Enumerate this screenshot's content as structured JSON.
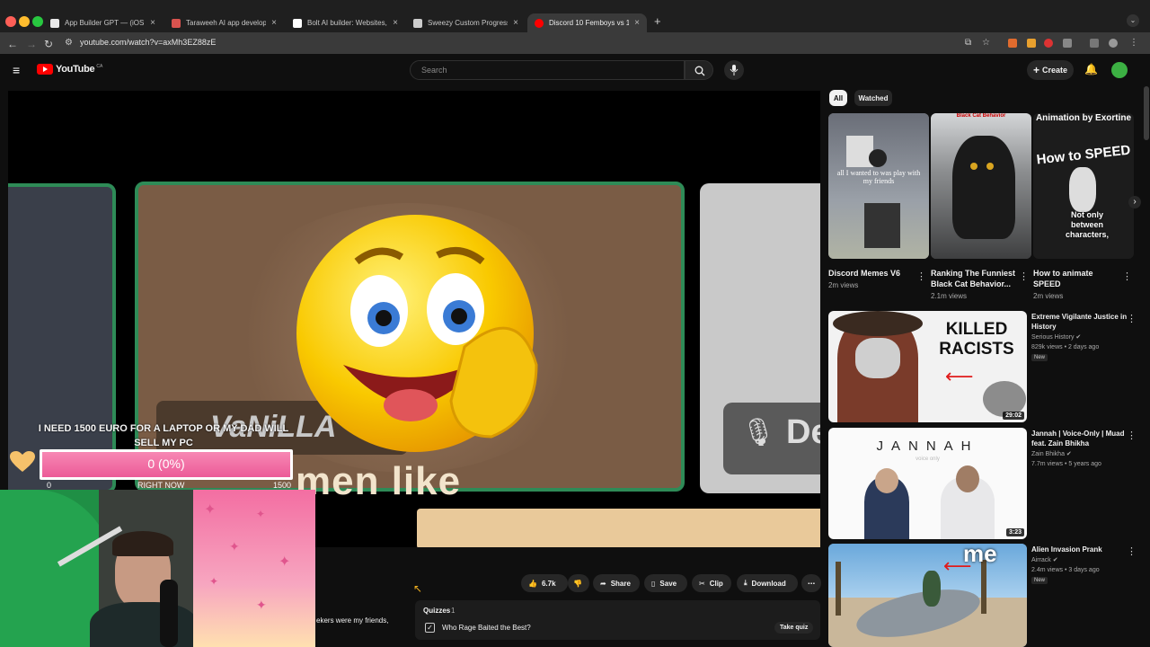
{
  "browser": {
    "tabs": [
      {
        "label": "App Builder GPT — (iOS & An",
        "favicon_color": "#e8e8e8"
      },
      {
        "label": "Taraweeh AI app developme",
        "favicon_color": "#d9534f"
      },
      {
        "label": "Bolt AI builder: Websites, app",
        "favicon_color": "#ffffff"
      },
      {
        "label": "Sweezy Custom Progress Bar",
        "favicon_color": "#cccccc"
      },
      {
        "label": "Discord 10 Femboys vs 1",
        "favicon_color": "#ff0000"
      }
    ],
    "url": "youtube.com/watch?v=axMh3EZ88zE"
  },
  "youtube": {
    "logo_text": "YouTube",
    "logo_suffix": "CA",
    "search_placeholder": "Search",
    "create_label": "Create"
  },
  "overlay": {
    "goal_text_line1": "I NEED 1500 EURO FOR A LAPTOP OR MY DAD WILL",
    "goal_text_line2": "SELL MY PC",
    "progress_label": "0 (0%)",
    "progress_fraction": 0.0,
    "min_label": "0",
    "mid_label": "RIGHT NOW",
    "max_label": "1500"
  },
  "video": {
    "caption": "men like",
    "badge_text": "VaNiLLA",
    "side_text": "De"
  },
  "actions": {
    "like_count": "6.7k",
    "share": "Share",
    "save": "Save",
    "clip": "Clip",
    "download": "Download"
  },
  "quiz": {
    "header": "Quizzes",
    "count": "1",
    "question": "Who Rage Baited the Best?",
    "take_label": "Take quiz"
  },
  "comment_snippet": "ekers were my friends,",
  "filters": {
    "all": "All",
    "watched": "Watched"
  },
  "shorts": [
    {
      "title": "Discord Memes V6",
      "views": "2m views",
      "thumb_text": "all I wanted to was play with my friends"
    },
    {
      "title": "Ranking The Funniest Black Cat Behavior...",
      "views": "2.1m views",
      "thumb_text": "Black Cat Behavior"
    },
    {
      "title": "How to animate SPEED",
      "views": "2m views",
      "thumb_text": "Animation by Exortine",
      "thumb_sub": "How to SPEED",
      "thumb_sub2": "Not only between characters,"
    }
  ],
  "related": [
    {
      "title": "Extreme Vigilante Justice in History",
      "channel": "Serious History",
      "meta": "829k views • 2 days ago",
      "badge": "New",
      "duration": "29:02",
      "thumb_text": "KILLED RACISTS"
    },
    {
      "title": "Jannah | Voice-Only | Muad feat. Zain Bhikha",
      "channel": "Zain Bhikha",
      "meta": "7.7m views • 5 years ago",
      "badge": "",
      "duration": "3:23",
      "thumb_text": "JANNAH",
      "thumb_sub": "voice only"
    },
    {
      "title": "Alien Invasion Prank",
      "channel": "Airrack",
      "meta": "2.4m views • 3 days ago",
      "badge": "New",
      "duration": "",
      "thumb_text": "me"
    }
  ]
}
